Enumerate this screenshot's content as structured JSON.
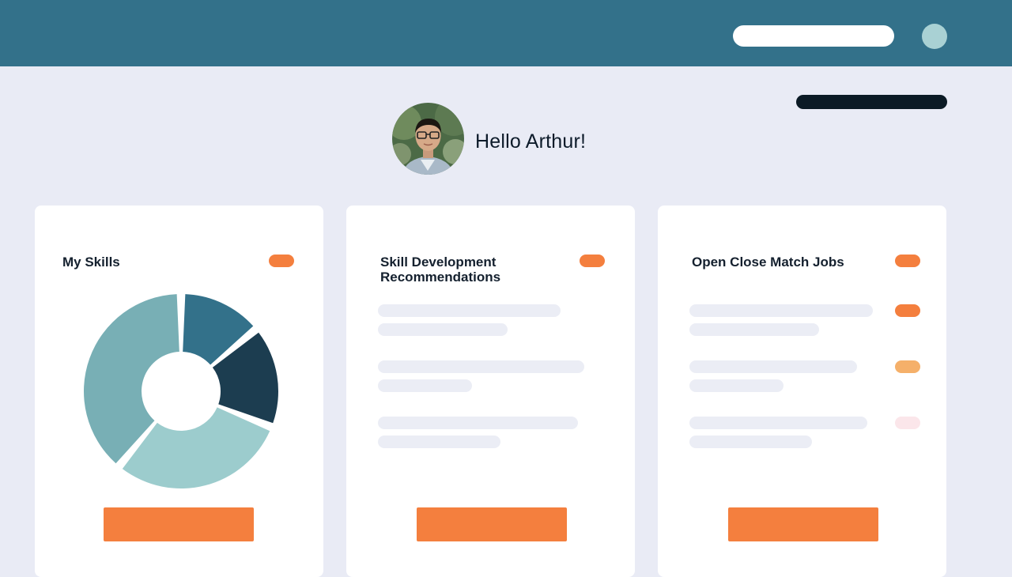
{
  "header": {
    "greeting": "Hello Arthur!"
  },
  "colors": {
    "header_bg": "#33718a",
    "accent": "#f47f3e",
    "accent_light": "#f5b06a",
    "accent_faint": "#fbe6ea",
    "skeleton": "#ebedf5",
    "page_bg": "#e9ebf5"
  },
  "cards": [
    {
      "title": "My Skills"
    },
    {
      "title_line1": "Skill Development",
      "title_line2": "Recommendations"
    },
    {
      "title": "Open Close Match Jobs"
    }
  ],
  "chart_data": {
    "type": "pie",
    "values": [
      14,
      17,
      30,
      39
    ],
    "colors": [
      "#33718a",
      "#1c3d50",
      "#9ccccd",
      "#78afb5"
    ]
  }
}
